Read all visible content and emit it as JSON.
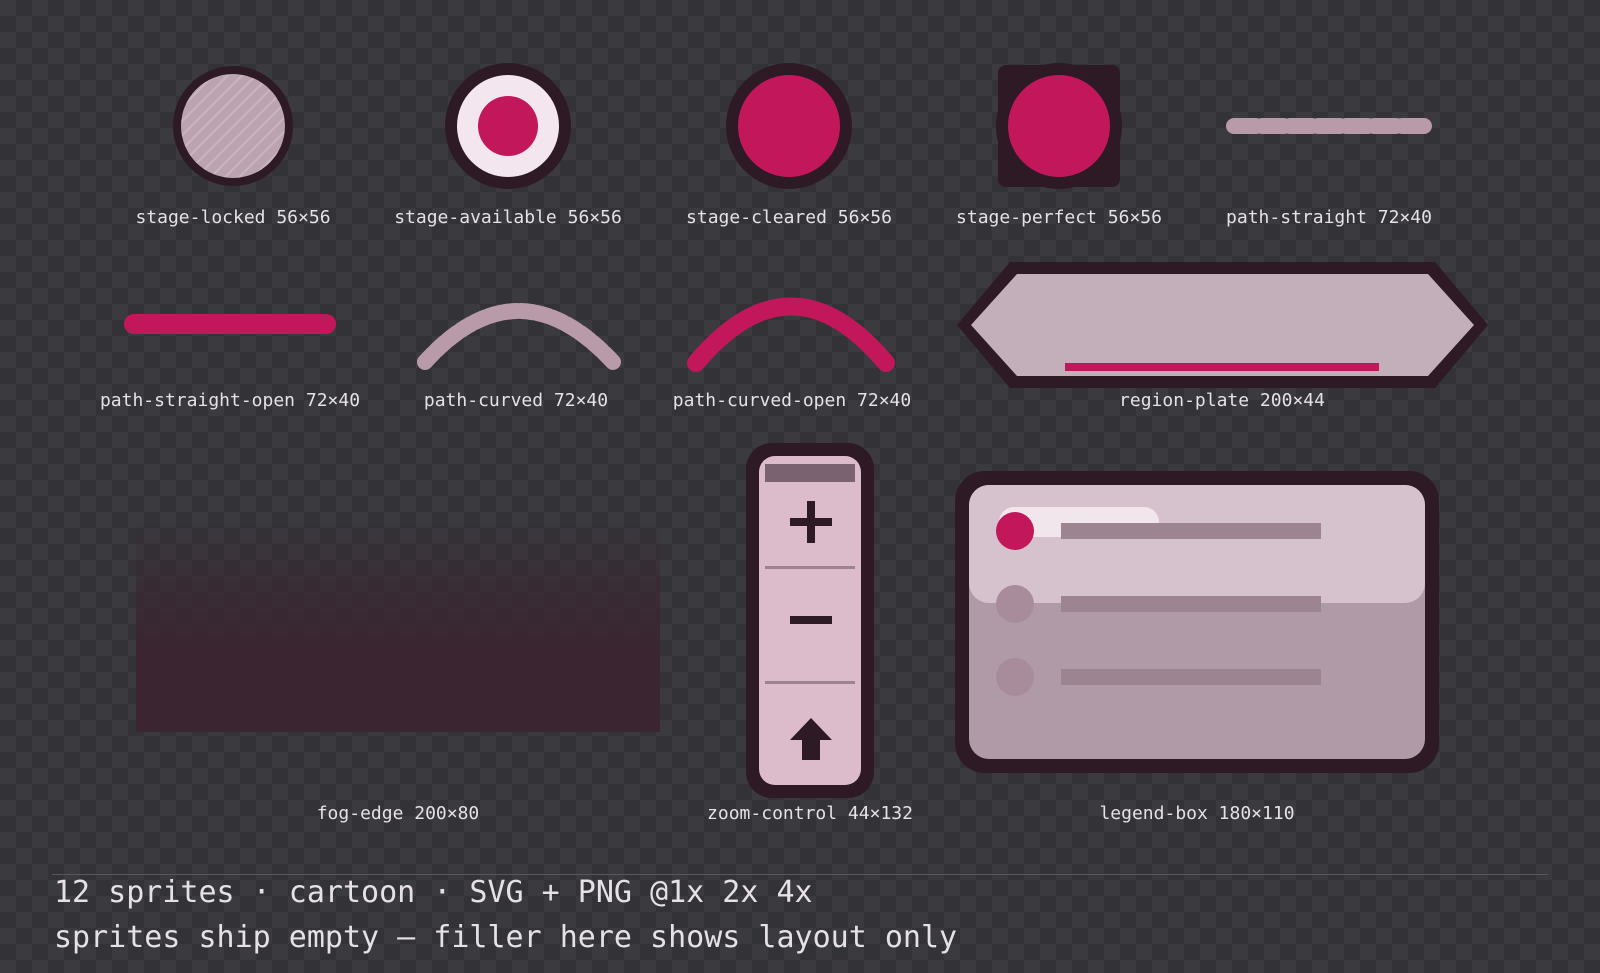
{
  "sprites": [
    {
      "id": "stage-locked",
      "caption": "stage-locked 56×56"
    },
    {
      "id": "stage-available",
      "caption": "stage-available 56×56"
    },
    {
      "id": "stage-cleared",
      "caption": "stage-cleared 56×56"
    },
    {
      "id": "stage-perfect",
      "caption": "stage-perfect 56×56"
    },
    {
      "id": "path-straight",
      "caption": "path-straight 72×40"
    },
    {
      "id": "path-straight-open",
      "caption": "path-straight-open 72×40"
    },
    {
      "id": "path-curved",
      "caption": "path-curved 72×40"
    },
    {
      "id": "path-curved-open",
      "caption": "path-curved-open 72×40"
    },
    {
      "id": "region-plate",
      "caption": "region-plate 200×44"
    },
    {
      "id": "fog-edge",
      "caption": "fog-edge 200×80"
    },
    {
      "id": "zoom-control",
      "caption": "zoom-control 44×132"
    },
    {
      "id": "legend-box",
      "caption": "legend-box 180×110"
    }
  ],
  "footer": {
    "line1": "12 sprites · cartoon · SVG + PNG @1x 2x 4x",
    "line2": "sprites ship empty — filler here shows layout only"
  },
  "colors": {
    "accent": "#c2185b",
    "outline": "#2d1a25",
    "fill_light": "#d9c0cb",
    "fill_muted": "#b09aa7",
    "fog": "#3a2530"
  },
  "icons": {
    "zoom_in": "plus-icon",
    "zoom_out": "minus-icon",
    "recenter": "arrow-up-icon"
  }
}
